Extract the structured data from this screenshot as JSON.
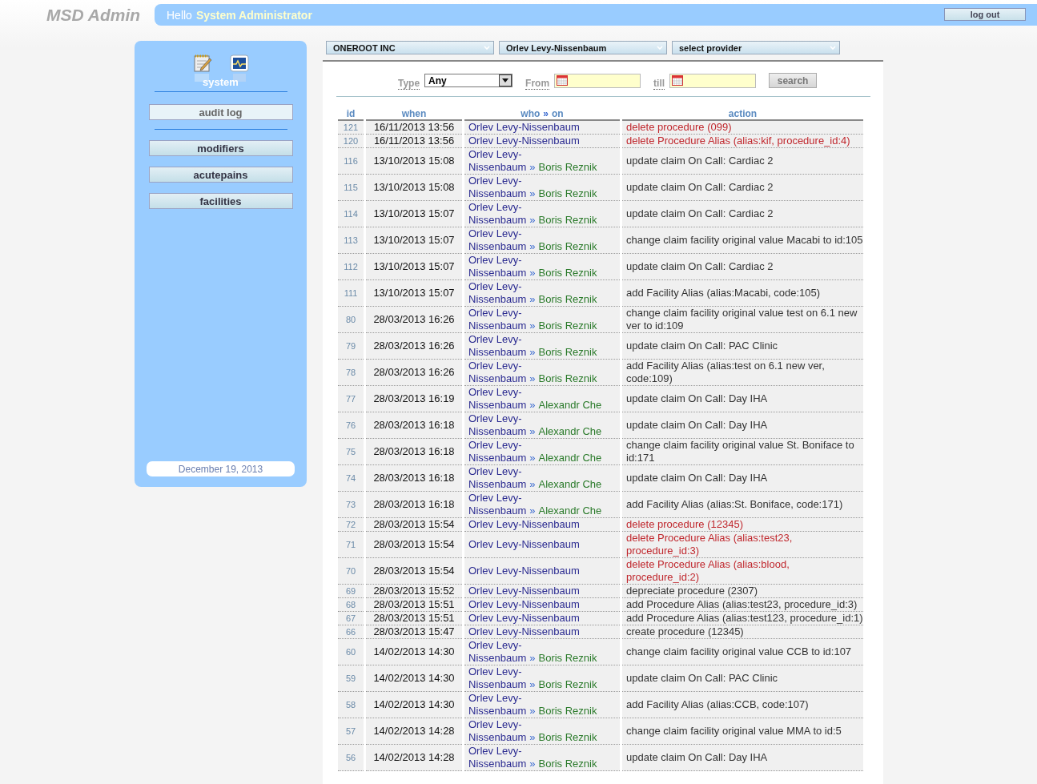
{
  "header": {
    "logo": "MSD Admin",
    "greeting": "Hello",
    "user": "System Administrator",
    "logout": "log out"
  },
  "sidebar": {
    "section": "system",
    "items": [
      {
        "label": "audit log",
        "selected": true
      },
      {
        "label": "modifiers",
        "selected": false
      },
      {
        "label": "acutepains",
        "selected": false
      },
      {
        "label": "facilities",
        "selected": false
      }
    ],
    "date": "December 19, 2013"
  },
  "selectors": [
    "ONEROOT INC",
    "Orlev Levy-Nissenbaum",
    "select provider"
  ],
  "filter": {
    "type_label": "Type",
    "type_value": "Any",
    "from_label": "From",
    "till_label": "till",
    "search": "search"
  },
  "table": {
    "columns": {
      "id": "id",
      "when": "when",
      "who": "who",
      "sep": "»",
      "on": "on",
      "action": "action"
    },
    "rows": [
      {
        "id": "121",
        "when": "16/11/2013 13:56",
        "who": "Orlev Levy-Nissenbaum",
        "action": "delete procedure (099)",
        "kind": "delete"
      },
      {
        "id": "120",
        "when": "16/11/2013 13:56",
        "who": "Orlev Levy-Nissenbaum",
        "action": "delete Procedure Alias (alias:kif, procedure_id:4)",
        "kind": "delete"
      },
      {
        "id": "116",
        "when": "13/10/2013 15:08",
        "who": "Orlev Levy-Nissenbaum",
        "sep": "»",
        "on": "Boris Reznik",
        "action": "update claim On Call: Cardiac 2",
        "kind": "change"
      },
      {
        "id": "115",
        "when": "13/10/2013 15:08",
        "who": "Orlev Levy-Nissenbaum",
        "sep": "»",
        "on": "Boris Reznik",
        "action": "update claim On Call: Cardiac 2",
        "kind": "change"
      },
      {
        "id": "114",
        "when": "13/10/2013 15:07",
        "who": "Orlev Levy-Nissenbaum",
        "sep": "»",
        "on": "Boris Reznik",
        "action": "update claim On Call: Cardiac 2",
        "kind": "change"
      },
      {
        "id": "113",
        "when": "13/10/2013 15:07",
        "who": "Orlev Levy-Nissenbaum",
        "sep": "»",
        "on": "Boris Reznik",
        "action": "change claim facility original value Macabi to id:105",
        "kind": "change"
      },
      {
        "id": "112",
        "when": "13/10/2013 15:07",
        "who": "Orlev Levy-Nissenbaum",
        "sep": "»",
        "on": "Boris Reznik",
        "action": "update claim On Call: Cardiac 2",
        "kind": "change"
      },
      {
        "id": "111",
        "when": "13/10/2013 15:07",
        "who": "Orlev Levy-Nissenbaum",
        "sep": "»",
        "on": "Boris Reznik",
        "action": "add Facility Alias (alias:Macabi, code:105)",
        "kind": "change"
      },
      {
        "id": "80",
        "when": "28/03/2013 16:26",
        "who": "Orlev Levy-Nissenbaum",
        "sep": "»",
        "on": "Boris Reznik",
        "action": "change claim facility original value test on 6.1 new ver to id:109",
        "kind": "change"
      },
      {
        "id": "79",
        "when": "28/03/2013 16:26",
        "who": "Orlev Levy-Nissenbaum",
        "sep": "»",
        "on": "Boris Reznik",
        "action": "update claim On Call: PAC Clinic",
        "kind": "change"
      },
      {
        "id": "78",
        "when": "28/03/2013 16:26",
        "who": "Orlev Levy-Nissenbaum",
        "sep": "»",
        "on": "Boris Reznik",
        "action": "add Facility Alias (alias:test on 6.1 new ver, code:109)",
        "kind": "change"
      },
      {
        "id": "77",
        "when": "28/03/2013 16:19",
        "who": "Orlev Levy-Nissenbaum",
        "sep": "»",
        "on": "Alexandr Che",
        "action": "update claim On Call: Day IHA",
        "kind": "change"
      },
      {
        "id": "76",
        "when": "28/03/2013 16:18",
        "who": "Orlev Levy-Nissenbaum",
        "sep": "»",
        "on": "Alexandr Che",
        "action": "update claim On Call: Day IHA",
        "kind": "change"
      },
      {
        "id": "75",
        "when": "28/03/2013 16:18",
        "who": "Orlev Levy-Nissenbaum",
        "sep": "»",
        "on": "Alexandr Che",
        "action": "change claim facility original value St. Boniface to id:171",
        "kind": "change"
      },
      {
        "id": "74",
        "when": "28/03/2013 16:18",
        "who": "Orlev Levy-Nissenbaum",
        "sep": "»",
        "on": "Alexandr Che",
        "action": "update claim On Call: Day IHA",
        "kind": "change"
      },
      {
        "id": "73",
        "when": "28/03/2013 16:18",
        "who": "Orlev Levy-Nissenbaum",
        "sep": "»",
        "on": "Alexandr Che",
        "action": "add Facility Alias (alias:St. Boniface, code:171)",
        "kind": "change"
      },
      {
        "id": "72",
        "when": "28/03/2013 15:54",
        "who": "Orlev Levy-Nissenbaum",
        "action": "delete procedure (12345)",
        "kind": "delete"
      },
      {
        "id": "71",
        "when": "28/03/2013 15:54",
        "who": "Orlev Levy-Nissenbaum",
        "action": "delete Procedure Alias (alias:test23, procedure_id:3)",
        "kind": "delete"
      },
      {
        "id": "70",
        "when": "28/03/2013 15:54",
        "who": "Orlev Levy-Nissenbaum",
        "action": "delete Procedure Alias (alias:blood, procedure_id:2)",
        "kind": "delete"
      },
      {
        "id": "69",
        "when": "28/03/2013 15:52",
        "who": "Orlev Levy-Nissenbaum",
        "action": "depreciate procedure (2307)",
        "kind": "change"
      },
      {
        "id": "68",
        "when": "28/03/2013 15:51",
        "who": "Orlev Levy-Nissenbaum",
        "action": "add Procedure Alias (alias:test23, procedure_id:3)",
        "kind": "change"
      },
      {
        "id": "67",
        "when": "28/03/2013 15:51",
        "who": "Orlev Levy-Nissenbaum",
        "action": "add Procedure Alias (alias:test123, procedure_id:1)",
        "kind": "change"
      },
      {
        "id": "66",
        "when": "28/03/2013 15:47",
        "who": "Orlev Levy-Nissenbaum",
        "action": "create procedure (12345)",
        "kind": "change"
      },
      {
        "id": "60",
        "when": "14/02/2013 14:30",
        "who": "Orlev Levy-Nissenbaum",
        "sep": "»",
        "on": "Boris Reznik",
        "action": "change claim facility original value CCB to id:107",
        "kind": "change"
      },
      {
        "id": "59",
        "when": "14/02/2013 14:30",
        "who": "Orlev Levy-Nissenbaum",
        "sep": "»",
        "on": "Boris Reznik",
        "action": "update claim On Call: PAC Clinic",
        "kind": "change"
      },
      {
        "id": "58",
        "when": "14/02/2013 14:30",
        "who": "Orlev Levy-Nissenbaum",
        "sep": "»",
        "on": "Boris Reznik",
        "action": "add Facility Alias (alias:CCB, code:107)",
        "kind": "change"
      },
      {
        "id": "57",
        "when": "14/02/2013 14:28",
        "who": "Orlev Levy-Nissenbaum",
        "sep": "»",
        "on": "Boris Reznik",
        "action": "change claim facility original value MMA to id:5",
        "kind": "change"
      },
      {
        "id": "56",
        "when": "14/02/2013 14:28",
        "who": "Orlev Levy-Nissenbaum",
        "sep": "»",
        "on": "Boris Reznik",
        "action": "update claim On Call: Day IHA",
        "kind": "change"
      }
    ]
  }
}
